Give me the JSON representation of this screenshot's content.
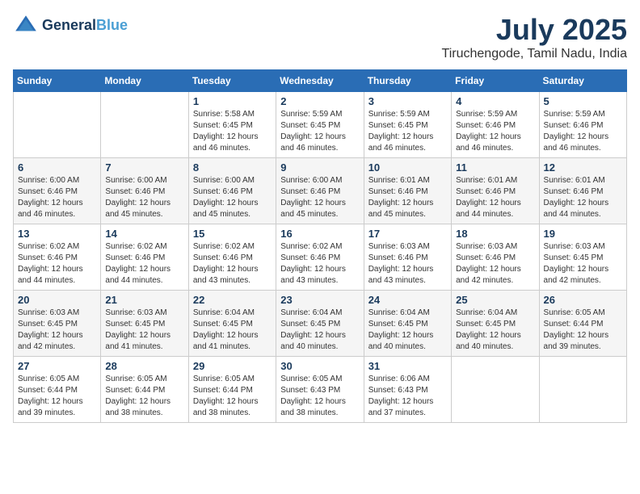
{
  "header": {
    "logo_line1": "General",
    "logo_line2": "Blue",
    "month_year": "July 2025",
    "location": "Tiruchengode, Tamil Nadu, India"
  },
  "weekdays": [
    "Sunday",
    "Monday",
    "Tuesday",
    "Wednesday",
    "Thursday",
    "Friday",
    "Saturday"
  ],
  "weeks": [
    [
      {
        "day": "",
        "sunrise": "",
        "sunset": "",
        "daylight": ""
      },
      {
        "day": "",
        "sunrise": "",
        "sunset": "",
        "daylight": ""
      },
      {
        "day": "1",
        "sunrise": "Sunrise: 5:58 AM",
        "sunset": "Sunset: 6:45 PM",
        "daylight": "Daylight: 12 hours and 46 minutes."
      },
      {
        "day": "2",
        "sunrise": "Sunrise: 5:59 AM",
        "sunset": "Sunset: 6:45 PM",
        "daylight": "Daylight: 12 hours and 46 minutes."
      },
      {
        "day": "3",
        "sunrise": "Sunrise: 5:59 AM",
        "sunset": "Sunset: 6:45 PM",
        "daylight": "Daylight: 12 hours and 46 minutes."
      },
      {
        "day": "4",
        "sunrise": "Sunrise: 5:59 AM",
        "sunset": "Sunset: 6:46 PM",
        "daylight": "Daylight: 12 hours and 46 minutes."
      },
      {
        "day": "5",
        "sunrise": "Sunrise: 5:59 AM",
        "sunset": "Sunset: 6:46 PM",
        "daylight": "Daylight: 12 hours and 46 minutes."
      }
    ],
    [
      {
        "day": "6",
        "sunrise": "Sunrise: 6:00 AM",
        "sunset": "Sunset: 6:46 PM",
        "daylight": "Daylight: 12 hours and 46 minutes."
      },
      {
        "day": "7",
        "sunrise": "Sunrise: 6:00 AM",
        "sunset": "Sunset: 6:46 PM",
        "daylight": "Daylight: 12 hours and 45 minutes."
      },
      {
        "day": "8",
        "sunrise": "Sunrise: 6:00 AM",
        "sunset": "Sunset: 6:46 PM",
        "daylight": "Daylight: 12 hours and 45 minutes."
      },
      {
        "day": "9",
        "sunrise": "Sunrise: 6:00 AM",
        "sunset": "Sunset: 6:46 PM",
        "daylight": "Daylight: 12 hours and 45 minutes."
      },
      {
        "day": "10",
        "sunrise": "Sunrise: 6:01 AM",
        "sunset": "Sunset: 6:46 PM",
        "daylight": "Daylight: 12 hours and 45 minutes."
      },
      {
        "day": "11",
        "sunrise": "Sunrise: 6:01 AM",
        "sunset": "Sunset: 6:46 PM",
        "daylight": "Daylight: 12 hours and 44 minutes."
      },
      {
        "day": "12",
        "sunrise": "Sunrise: 6:01 AM",
        "sunset": "Sunset: 6:46 PM",
        "daylight": "Daylight: 12 hours and 44 minutes."
      }
    ],
    [
      {
        "day": "13",
        "sunrise": "Sunrise: 6:02 AM",
        "sunset": "Sunset: 6:46 PM",
        "daylight": "Daylight: 12 hours and 44 minutes."
      },
      {
        "day": "14",
        "sunrise": "Sunrise: 6:02 AM",
        "sunset": "Sunset: 6:46 PM",
        "daylight": "Daylight: 12 hours and 44 minutes."
      },
      {
        "day": "15",
        "sunrise": "Sunrise: 6:02 AM",
        "sunset": "Sunset: 6:46 PM",
        "daylight": "Daylight: 12 hours and 43 minutes."
      },
      {
        "day": "16",
        "sunrise": "Sunrise: 6:02 AM",
        "sunset": "Sunset: 6:46 PM",
        "daylight": "Daylight: 12 hours and 43 minutes."
      },
      {
        "day": "17",
        "sunrise": "Sunrise: 6:03 AM",
        "sunset": "Sunset: 6:46 PM",
        "daylight": "Daylight: 12 hours and 43 minutes."
      },
      {
        "day": "18",
        "sunrise": "Sunrise: 6:03 AM",
        "sunset": "Sunset: 6:46 PM",
        "daylight": "Daylight: 12 hours and 42 minutes."
      },
      {
        "day": "19",
        "sunrise": "Sunrise: 6:03 AM",
        "sunset": "Sunset: 6:45 PM",
        "daylight": "Daylight: 12 hours and 42 minutes."
      }
    ],
    [
      {
        "day": "20",
        "sunrise": "Sunrise: 6:03 AM",
        "sunset": "Sunset: 6:45 PM",
        "daylight": "Daylight: 12 hours and 42 minutes."
      },
      {
        "day": "21",
        "sunrise": "Sunrise: 6:03 AM",
        "sunset": "Sunset: 6:45 PM",
        "daylight": "Daylight: 12 hours and 41 minutes."
      },
      {
        "day": "22",
        "sunrise": "Sunrise: 6:04 AM",
        "sunset": "Sunset: 6:45 PM",
        "daylight": "Daylight: 12 hours and 41 minutes."
      },
      {
        "day": "23",
        "sunrise": "Sunrise: 6:04 AM",
        "sunset": "Sunset: 6:45 PM",
        "daylight": "Daylight: 12 hours and 40 minutes."
      },
      {
        "day": "24",
        "sunrise": "Sunrise: 6:04 AM",
        "sunset": "Sunset: 6:45 PM",
        "daylight": "Daylight: 12 hours and 40 minutes."
      },
      {
        "day": "25",
        "sunrise": "Sunrise: 6:04 AM",
        "sunset": "Sunset: 6:45 PM",
        "daylight": "Daylight: 12 hours and 40 minutes."
      },
      {
        "day": "26",
        "sunrise": "Sunrise: 6:05 AM",
        "sunset": "Sunset: 6:44 PM",
        "daylight": "Daylight: 12 hours and 39 minutes."
      }
    ],
    [
      {
        "day": "27",
        "sunrise": "Sunrise: 6:05 AM",
        "sunset": "Sunset: 6:44 PM",
        "daylight": "Daylight: 12 hours and 39 minutes."
      },
      {
        "day": "28",
        "sunrise": "Sunrise: 6:05 AM",
        "sunset": "Sunset: 6:44 PM",
        "daylight": "Daylight: 12 hours and 38 minutes."
      },
      {
        "day": "29",
        "sunrise": "Sunrise: 6:05 AM",
        "sunset": "Sunset: 6:44 PM",
        "daylight": "Daylight: 12 hours and 38 minutes."
      },
      {
        "day": "30",
        "sunrise": "Sunrise: 6:05 AM",
        "sunset": "Sunset: 6:43 PM",
        "daylight": "Daylight: 12 hours and 38 minutes."
      },
      {
        "day": "31",
        "sunrise": "Sunrise: 6:06 AM",
        "sunset": "Sunset: 6:43 PM",
        "daylight": "Daylight: 12 hours and 37 minutes."
      },
      {
        "day": "",
        "sunrise": "",
        "sunset": "",
        "daylight": ""
      },
      {
        "day": "",
        "sunrise": "",
        "sunset": "",
        "daylight": ""
      }
    ]
  ]
}
